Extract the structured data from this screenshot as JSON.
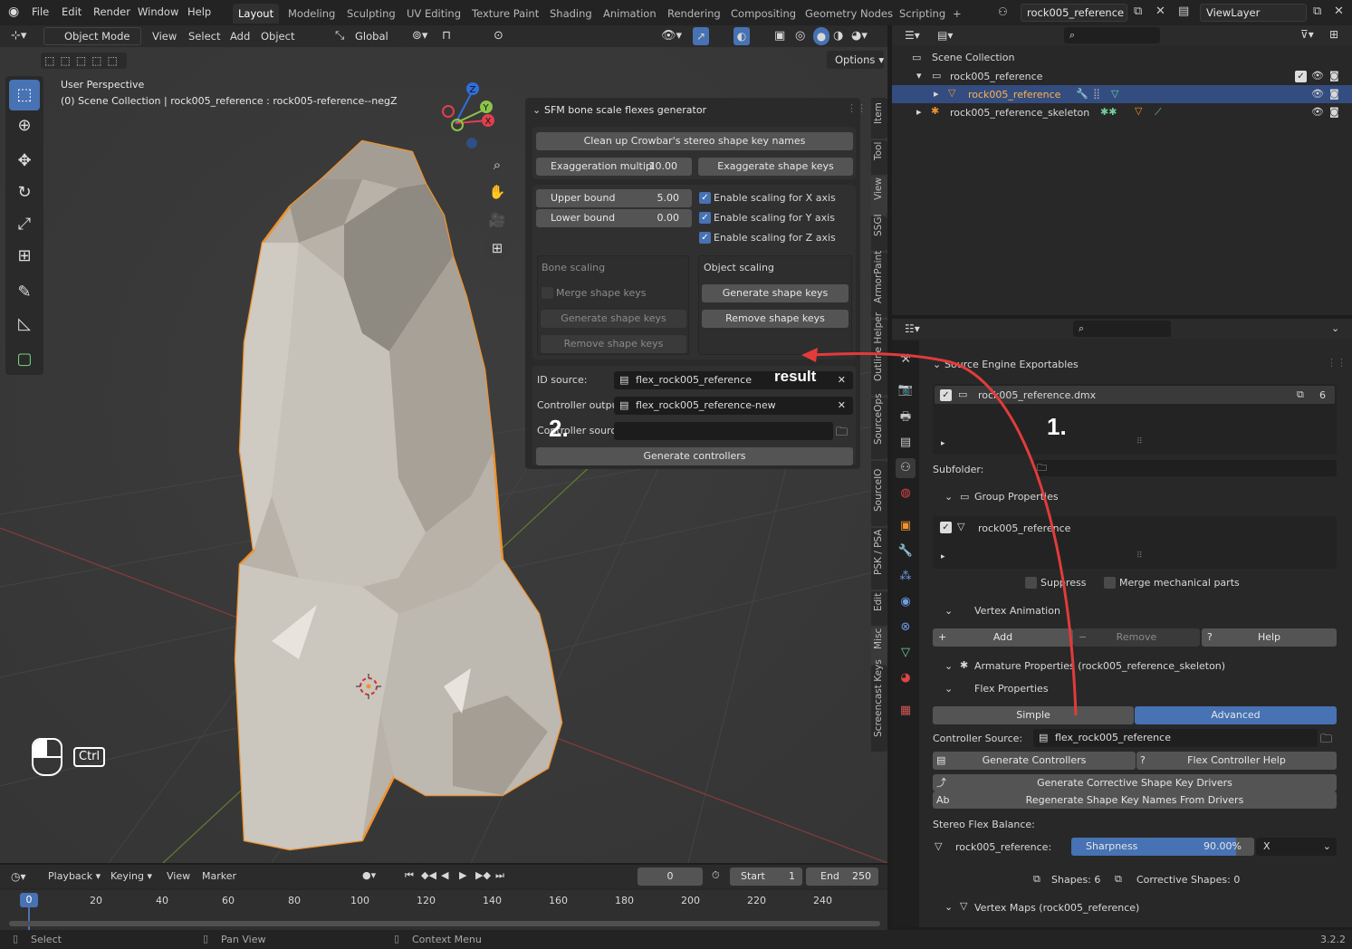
{
  "topbar": {
    "menus": [
      "File",
      "Edit",
      "Render",
      "Window",
      "Help"
    ],
    "workspaces": [
      "Layout",
      "Modeling",
      "Sculpting",
      "UV Editing",
      "Texture Paint",
      "Shading",
      "Animation",
      "Rendering",
      "Compositing",
      "Geometry Nodes",
      "Scripting"
    ],
    "active_workspace": "Layout",
    "add_workspace": "+",
    "scene_name": "rock005_reference",
    "view_layer": "ViewLayer"
  },
  "viewport_header": {
    "mode": "Object Mode",
    "menus": [
      "View",
      "Select",
      "Add",
      "Object"
    ],
    "orientation": "Global",
    "options": "Options"
  },
  "viewport": {
    "perspective": "User Perspective",
    "collection_info": "(0) Scene Collection | rock005_reference : rock005-reference--negZ",
    "gizmo": {
      "x": "X",
      "y": "Y",
      "z": "Z"
    },
    "keys": {
      "ctrl": "Ctrl"
    }
  },
  "tools": [
    {
      "name": "select-box-icon",
      "glyph": "⬚"
    },
    {
      "name": "cursor-icon",
      "glyph": "⊕"
    },
    {
      "name": "move-icon",
      "glyph": "✥"
    },
    {
      "name": "rotate-icon",
      "glyph": "↻"
    },
    {
      "name": "scale-icon",
      "glyph": "⤢"
    },
    {
      "name": "transform-icon",
      "glyph": "⊞"
    },
    {
      "name": "annotate-icon",
      "glyph": "✎"
    },
    {
      "name": "measure-icon",
      "glyph": "📐"
    },
    {
      "name": "add-cube-icon",
      "glyph": "▢"
    }
  ],
  "sidepanel": {
    "title": "SFM bone scale flexes generator",
    "cleanup_button": "Clean up Crowbar's stereo shape key names",
    "exaggeration_label": "Exaggeration multipl",
    "exaggeration_value": "10.00",
    "exaggerate_button": "Exaggerate shape keys",
    "upper_bound_label": "Upper bound",
    "upper_bound_value": "5.00",
    "lower_bound_label": "Lower bound",
    "lower_bound_value": "0.00",
    "enable_x": "Enable scaling for X axis",
    "enable_y": "Enable scaling for Y axis",
    "enable_z": "Enable scaling for Z axis",
    "bone_scaling": "Bone scaling",
    "merge_shape_keys": "Merge shape keys",
    "bone_generate": "Generate shape keys",
    "bone_remove": "Remove shape keys",
    "object_scaling": "Object scaling",
    "object_generate": "Generate shape keys",
    "object_remove": "Remove shape keys",
    "id_source_label": "ID source:",
    "id_source_value": "flex_rock005_reference",
    "controller_output_label": "Controller output",
    "controller_output_value": "flex_rock005_reference-new",
    "controller_source_label": "Controller sourc",
    "generate_controllers": "Generate controllers"
  },
  "annotations": {
    "step1": "1.",
    "step2": "2.",
    "result": "result"
  },
  "sidebar_tabs": [
    "Item",
    "Tool",
    "View",
    "SSGI",
    "ArmorPaint",
    "Outline Helper",
    "SourceOps",
    "SourceIO",
    "PSK / PSA",
    "Edit",
    "Misc",
    "Screencast Keys"
  ],
  "outliner": {
    "title": "Scene Collection",
    "rows": [
      {
        "label": "rock005_reference"
      },
      {
        "label": "rock005_reference"
      },
      {
        "label": "rock005_reference_skeleton"
      }
    ]
  },
  "properties": {
    "section": "Source Engine Exportables",
    "exportable_name": "rock005_reference.dmx",
    "exportable_count": "6",
    "subfolder_label": "Subfolder:",
    "group_properties": "Group Properties",
    "group_item": "rock005_reference",
    "suppress": "Suppress",
    "merge_mech": "Merge mechanical parts",
    "vertex_animation": "Vertex Animation",
    "add": "Add",
    "remove": "Remove",
    "help": "Help",
    "armature_props": "Armature Properties (rock005_reference_skeleton)",
    "flex_props": "Flex Properties",
    "simple": "Simple",
    "advanced": "Advanced",
    "controller_source_label": "Controller Source:",
    "controller_source_value": "flex_rock005_reference",
    "generate_controllers": "Generate Controllers",
    "flex_help": "Flex Controller Help",
    "gen_corrective": "Generate Corrective Shape Key Drivers",
    "regen_names": "Regenerate Shape Key Names From Drivers",
    "stereo_balance": "Stereo Flex Balance:",
    "stereo_object": "rock005_reference:",
    "sharpness_label": "Sharpness",
    "sharpness_value": "90.00%",
    "sharpness_fraction": 0.9,
    "axis": "X",
    "shapes": "Shapes: 6",
    "corrective": "Corrective Shapes: 0",
    "vertex_maps": "Vertex Maps (rock005_reference)"
  },
  "timeline": {
    "menus": [
      "Playback",
      "Keying",
      "View",
      "Marker"
    ],
    "current_frame": "0",
    "start_label": "Start",
    "start": "1",
    "end_label": "End",
    "end": "250",
    "ticks": [
      "0",
      "20",
      "40",
      "60",
      "80",
      "100",
      "120",
      "140",
      "160",
      "180",
      "200",
      "220",
      "240"
    ]
  },
  "statusbar": {
    "select": "Select",
    "pan": "Pan View",
    "context": "Context Menu",
    "version": "3.2.2"
  }
}
